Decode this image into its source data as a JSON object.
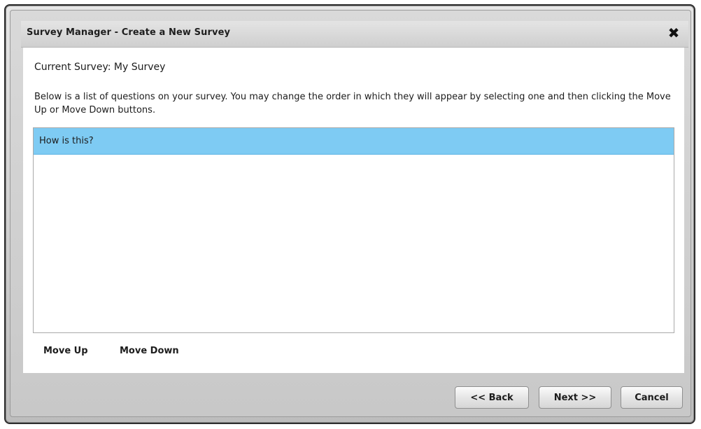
{
  "dialog": {
    "title": "Survey Manager - Create a New Survey",
    "close_icon_glyph": "✖"
  },
  "content": {
    "current_survey": "Current Survey: My Survey",
    "instructions": "Below is a list of questions on your survey. You may change the order in which they will appear by selecting one and then clicking the Move Up or Move Down buttons."
  },
  "questions": [
    {
      "label": "How is this?",
      "selected": true
    }
  ],
  "actions": {
    "move_up": "Move Up",
    "move_down": "Move Down"
  },
  "footer": {
    "back": "<< Back",
    "next": "Next >>",
    "cancel": "Cancel"
  },
  "colors": {
    "selection": "#7ecbf3",
    "frame_border": "#2e2e2e"
  }
}
